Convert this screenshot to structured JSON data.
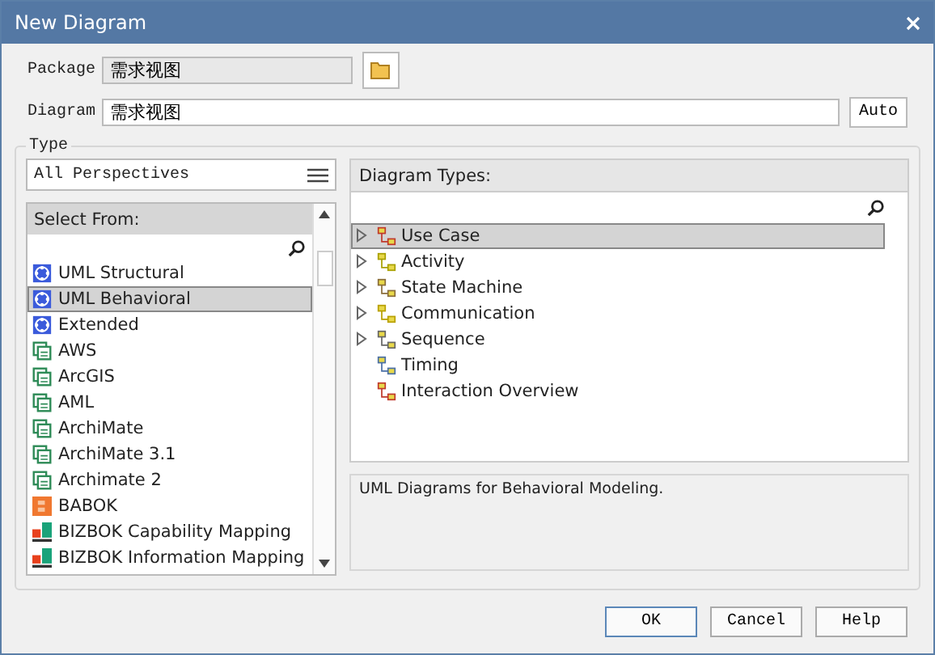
{
  "window": {
    "title": "New Diagram"
  },
  "package": {
    "label": "Package",
    "value": "需求视图"
  },
  "diagram": {
    "label": "Diagram",
    "value": "需求视图",
    "auto_button": "Auto"
  },
  "type_group": {
    "label": "Type",
    "perspective": {
      "value": "All Perspectives"
    },
    "select_from": {
      "header": "Select From:",
      "items": [
        {
          "label": "UML Structural",
          "kind": "uml",
          "selected": false
        },
        {
          "label": "UML Behavioral",
          "kind": "uml",
          "selected": true
        },
        {
          "label": "Extended",
          "kind": "uml",
          "selected": false
        },
        {
          "label": "AWS",
          "kind": "mdg",
          "selected": false
        },
        {
          "label": "ArcGIS",
          "kind": "mdg",
          "selected": false
        },
        {
          "label": "AML",
          "kind": "mdg",
          "selected": false
        },
        {
          "label": "ArchiMate",
          "kind": "mdg",
          "selected": false
        },
        {
          "label": "ArchiMate 3.1",
          "kind": "mdg",
          "selected": false
        },
        {
          "label": "Archimate 2",
          "kind": "mdg",
          "selected": false
        },
        {
          "label": "BABOK",
          "kind": "babok",
          "selected": false
        },
        {
          "label": "BIZBOK Capability Mapping",
          "kind": "bizbok",
          "selected": false
        },
        {
          "label": "BIZBOK Information Mapping",
          "kind": "bizbok",
          "selected": false
        }
      ]
    },
    "diagram_types": {
      "header": "Diagram Types:",
      "items": [
        {
          "label": "Use Case",
          "kind": "usecase",
          "expandable": true,
          "selected": true
        },
        {
          "label": "Activity",
          "kind": "activity",
          "expandable": true,
          "selected": false
        },
        {
          "label": "State Machine",
          "kind": "state",
          "expandable": true,
          "selected": false
        },
        {
          "label": "Communication",
          "kind": "communication",
          "expandable": true,
          "selected": false
        },
        {
          "label": "Sequence",
          "kind": "sequence",
          "expandable": true,
          "selected": false
        },
        {
          "label": "Timing",
          "kind": "timing",
          "expandable": false,
          "selected": false
        },
        {
          "label": "Interaction Overview",
          "kind": "interaction",
          "expandable": false,
          "selected": false
        }
      ]
    },
    "description": "UML Diagrams for Behavioral Modeling."
  },
  "buttons": [
    {
      "label": "OK",
      "default": true
    },
    {
      "label": "Cancel",
      "default": false
    },
    {
      "label": "Help",
      "default": false
    }
  ]
}
